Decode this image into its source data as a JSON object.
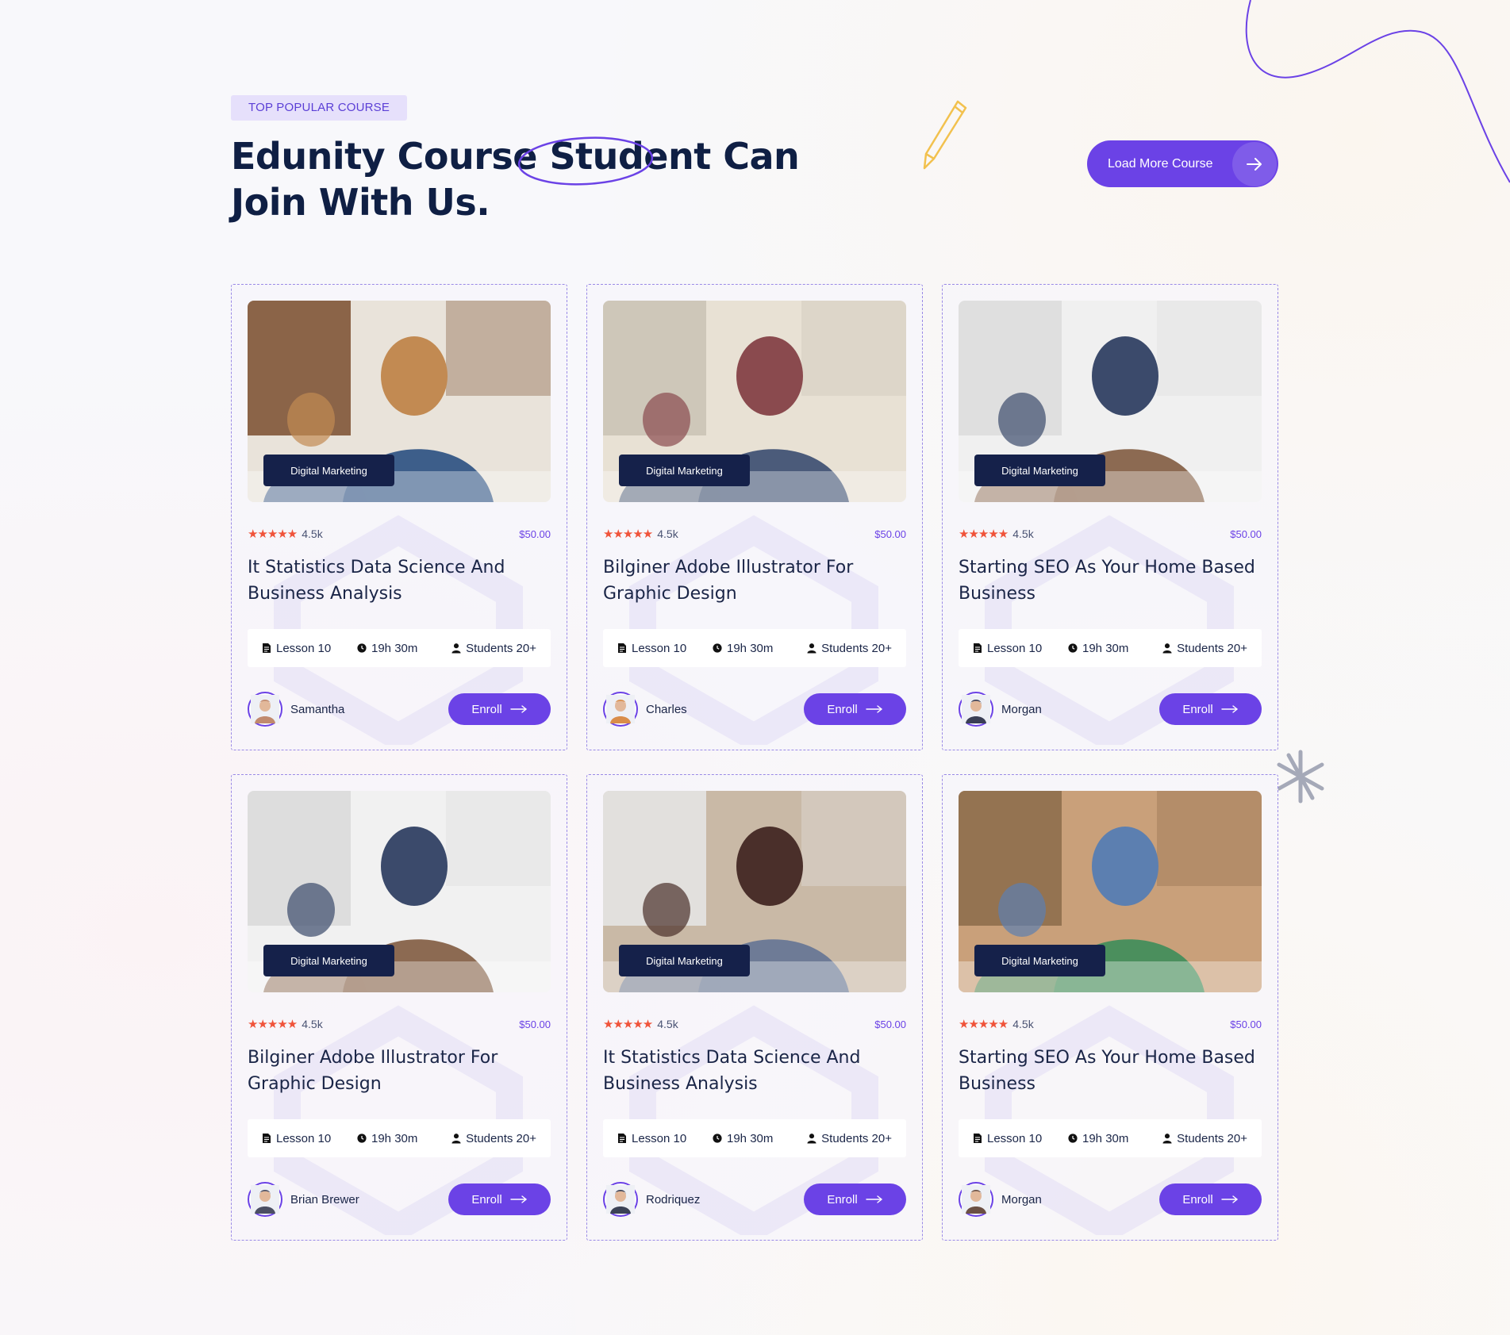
{
  "header": {
    "badge": "TOP POPULAR COURSE",
    "title_line1": "Edunity Course Student Can",
    "title_line2": "Join With Us.",
    "load_more_label": "Load More Course"
  },
  "colors": {
    "accent": "#6b42e6",
    "dark": "#15214a",
    "star": "#f0533a"
  },
  "courses": [
    {
      "category": "Digital Marketing",
      "rating": "4.5k",
      "price": "$50.00",
      "title": "It Statistics Data Science And Business Analysis",
      "lessons": "Lesson 10",
      "duration": "19h 30m",
      "students": "Students 20+",
      "author": "Samantha",
      "enroll": "Enroll"
    },
    {
      "category": "Digital Marketing",
      "rating": "4.5k",
      "price": "$50.00",
      "title": "Bilginer Adobe Illustrator For Graphic Design",
      "lessons": "Lesson 10",
      "duration": "19h 30m",
      "students": "Students 20+",
      "author": "Charles",
      "enroll": "Enroll"
    },
    {
      "category": "Digital Marketing",
      "rating": "4.5k",
      "price": "$50.00",
      "title": "Starting SEO As Your Home Based Business",
      "lessons": "Lesson 10",
      "duration": "19h 30m",
      "students": "Students 20+",
      "author": "Morgan",
      "enroll": "Enroll"
    },
    {
      "category": "Digital Marketing",
      "rating": "4.5k",
      "price": "$50.00",
      "title": "Bilginer Adobe Illustrator For Graphic Design",
      "lessons": "Lesson 10",
      "duration": "19h 30m",
      "students": "Students 20+",
      "author": "Brian Brewer",
      "enroll": "Enroll"
    },
    {
      "category": "Digital Marketing",
      "rating": "4.5k",
      "price": "$50.00",
      "title": "It Statistics Data Science And Business Analysis",
      "lessons": "Lesson 10",
      "duration": "19h 30m",
      "students": "Students 20+",
      "author": "Rodriquez",
      "enroll": "Enroll"
    },
    {
      "category": "Digital Marketing",
      "rating": "4.5k",
      "price": "$50.00",
      "title": "Starting SEO As Your Home Based Business",
      "lessons": "Lesson 10",
      "duration": "19h 30m",
      "students": "Students 20+",
      "author": "Morgan",
      "enroll": "Enroll"
    }
  ]
}
